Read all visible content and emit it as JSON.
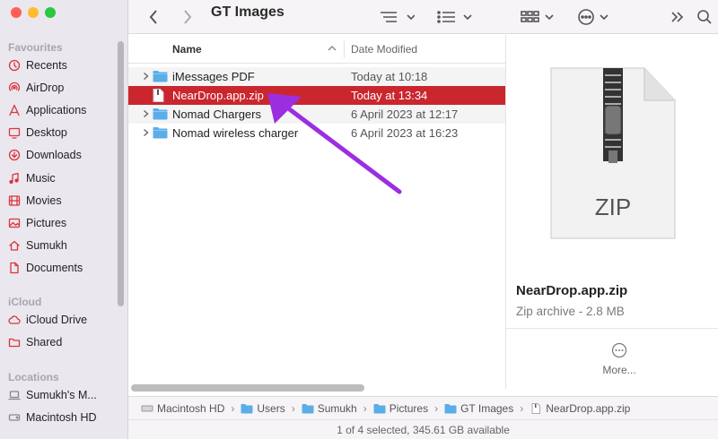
{
  "window": {
    "title": "GT Images"
  },
  "sidebar": {
    "sections": [
      {
        "title": "Favourites",
        "items": [
          {
            "label": "Recents",
            "icon": "clock-icon"
          },
          {
            "label": "AirDrop",
            "icon": "airdrop-icon"
          },
          {
            "label": "Applications",
            "icon": "applications-icon"
          },
          {
            "label": "Desktop",
            "icon": "desktop-icon"
          },
          {
            "label": "Downloads",
            "icon": "downloads-icon"
          },
          {
            "label": "Music",
            "icon": "music-icon"
          },
          {
            "label": "Movies",
            "icon": "movies-icon"
          },
          {
            "label": "Pictures",
            "icon": "pictures-icon"
          },
          {
            "label": "Sumukh",
            "icon": "home-icon"
          },
          {
            "label": "Documents",
            "icon": "documents-icon"
          }
        ]
      },
      {
        "title": "iCloud",
        "items": [
          {
            "label": "iCloud Drive",
            "icon": "cloud-icon"
          },
          {
            "label": "Shared",
            "icon": "shared-folder-icon"
          }
        ]
      },
      {
        "title": "Locations",
        "items": [
          {
            "label": "Sumukh's M...",
            "icon": "laptop-icon"
          },
          {
            "label": "Macintosh HD",
            "icon": "disk-icon"
          }
        ]
      }
    ]
  },
  "columns": {
    "name": "Name",
    "date": "Date Modified"
  },
  "files": [
    {
      "name": "iMessages PDF",
      "date": "Today at 10:18",
      "kind": "folder"
    },
    {
      "name": "NearDrop.app.zip",
      "date": "Today at 13:34",
      "kind": "zip",
      "selected": true
    },
    {
      "name": "Nomad Chargers",
      "date": "6 April 2023 at 12:17",
      "kind": "folder"
    },
    {
      "name": "Nomad wireless charger",
      "date": "6 April 2023 at 16:23",
      "kind": "folder"
    }
  ],
  "preview": {
    "icon_label": "ZIP",
    "name": "NearDrop.app.zip",
    "kind": "Zip archive - 2.8 MB",
    "more": "More..."
  },
  "path": [
    "Macintosh HD",
    "Users",
    "Sumukh",
    "Pictures",
    "GT Images",
    "NearDrop.app.zip"
  ],
  "status": "1 of 4 selected, 345.61 GB available",
  "colors": {
    "accent": "#c9262e",
    "folder": "#5aaee8",
    "sidebar_icon": "#d9363e",
    "pointer": "#9b2fe0"
  }
}
